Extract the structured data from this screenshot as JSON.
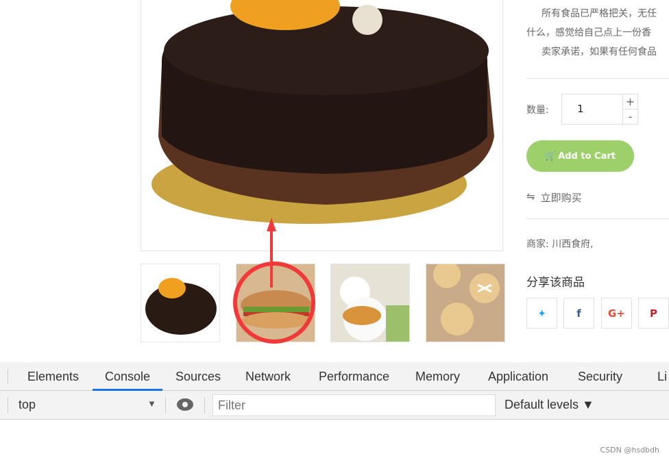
{
  "product": {
    "description_lines": [
      "所有食品已严格把关，无任",
      "什么，感觉给自己点上一份香",
      "卖家承诺，如果有任何食品"
    ],
    "quantity_label": "数量:",
    "quantity_value": "1",
    "plus": "+",
    "minus": "-",
    "add_to_cart": "Add to Cart",
    "buy_now": "立即购买",
    "seller": "商家: 川西食府,",
    "share_title": "分享该商品",
    "share_buttons": [
      {
        "icon": "twitter-icon",
        "glyph": "🐦",
        "color": "#1da1f2"
      },
      {
        "icon": "facebook-icon",
        "glyph": "f",
        "color": "#3b5998"
      },
      {
        "icon": "google-plus-icon",
        "glyph": "G+",
        "color": "#dd4b39"
      },
      {
        "icon": "pinterest-icon",
        "glyph": "P",
        "color": "#cb2027"
      }
    ],
    "accent": "#9dd06a",
    "thumbnails": [
      "cake",
      "sandwich",
      "croissant-breakfast",
      "hot-cross-buns"
    ]
  },
  "annotation": {
    "color": "#f03a3a"
  },
  "devtools": {
    "tabs": [
      "Elements",
      "Console",
      "Sources",
      "Network",
      "Performance",
      "Memory",
      "Application",
      "Security",
      "Li"
    ],
    "active_tab": "Console",
    "context": "top",
    "filter_placeholder": "Filter",
    "levels": "Default levels ▼"
  },
  "watermark": "CSDN @hsdbdh"
}
